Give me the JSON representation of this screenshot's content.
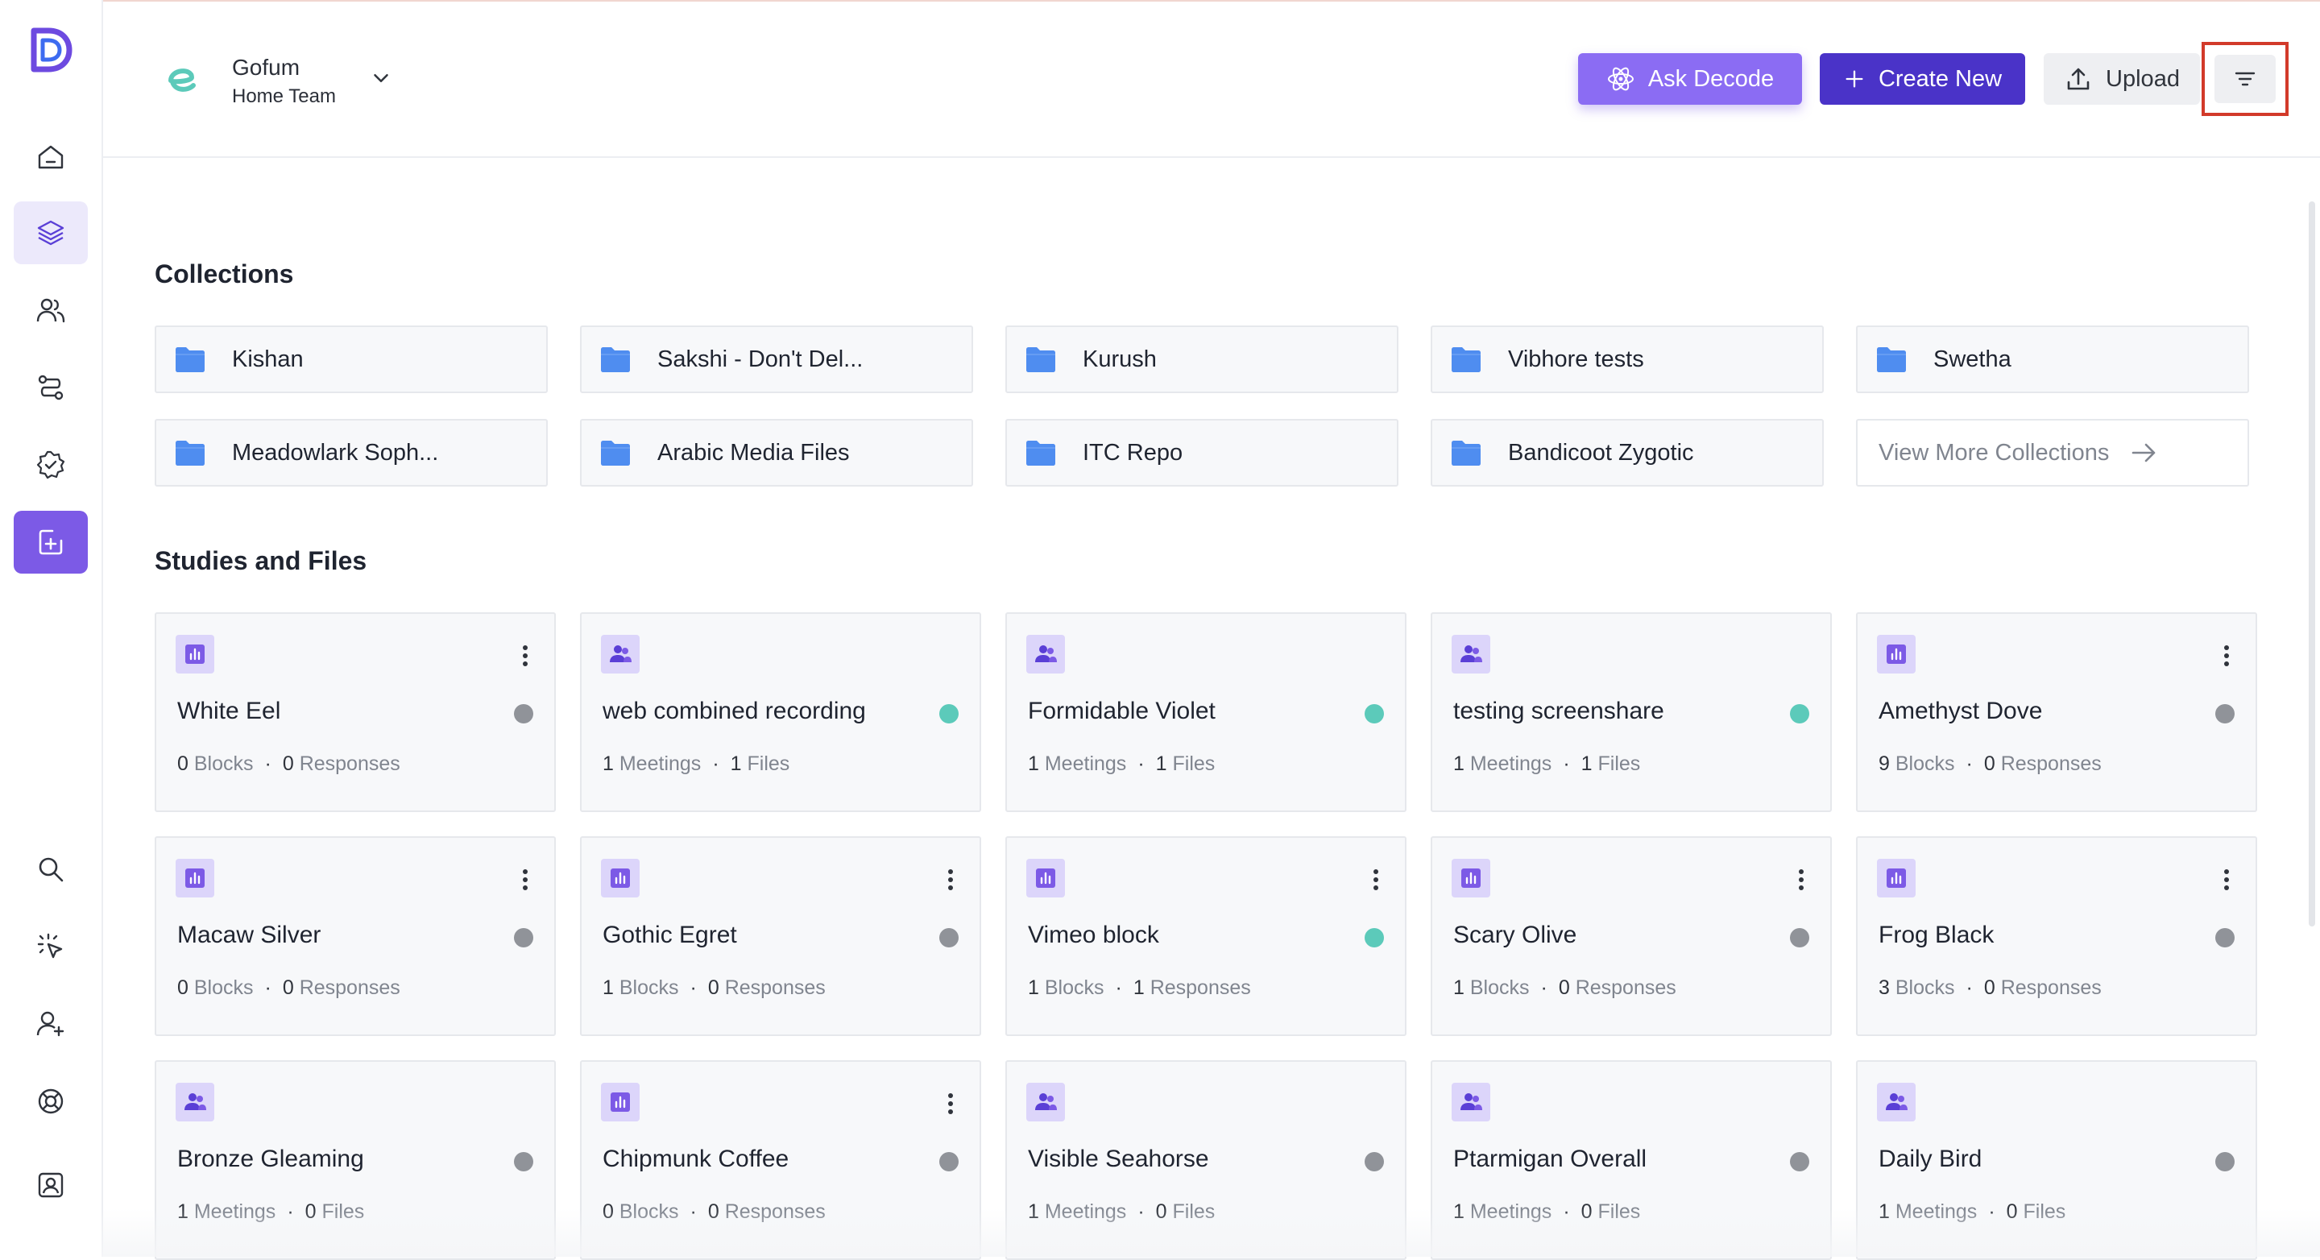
{
  "colors": {
    "accent": "#7c5ae6",
    "ask_button": "#8b6cf3",
    "create_button": "#4a33c8",
    "highlight": "#d23a2a",
    "status_active": "#5ccaba",
    "status_inactive": "#909399"
  },
  "sidebar": {
    "items": [
      {
        "name": "home",
        "icon": "home-icon"
      },
      {
        "name": "library",
        "icon": "layers-icon",
        "selected": true
      },
      {
        "name": "participants",
        "icon": "users-icon"
      },
      {
        "name": "flows",
        "icon": "route-icon"
      },
      {
        "name": "tasks",
        "icon": "check-circle-icon"
      },
      {
        "name": "new",
        "icon": "add-file-icon",
        "primary": true
      }
    ],
    "bottom_items": [
      {
        "name": "search",
        "icon": "search-icon"
      },
      {
        "name": "click-test",
        "icon": "cursor-click-icon"
      },
      {
        "name": "invite",
        "icon": "user-plus-icon"
      },
      {
        "name": "help",
        "icon": "lifebuoy-icon"
      },
      {
        "name": "profile",
        "icon": "user-card-icon"
      }
    ]
  },
  "header": {
    "workspace_name": "Gofum",
    "workspace_team": "Home Team",
    "ask_label": "Ask Decode",
    "create_label": "Create New",
    "upload_label": "Upload"
  },
  "collections": {
    "title": "Collections",
    "items": [
      "Kishan",
      "Sakshi - Don't Del...",
      "Kurush",
      "Vibhore tests",
      "Swetha",
      "Meadowlark Soph...",
      "Arabic Media Files",
      "ITC Repo",
      "Bandicoot Zygotic"
    ],
    "view_more_label": "View More Collections"
  },
  "studies": {
    "title": "Studies and Files",
    "items": [
      {
        "title": "White Eel",
        "kind": "block",
        "status": "inactive",
        "menu": true,
        "count1": "0",
        "label1": "Blocks",
        "count2": "0",
        "label2": "Responses"
      },
      {
        "title": "web combined recording",
        "kind": "meeting",
        "status": "active",
        "menu": false,
        "count1": "1",
        "label1": "Meetings",
        "count2": "1",
        "label2": "Files"
      },
      {
        "title": "Formidable Violet",
        "kind": "meeting",
        "status": "active",
        "menu": false,
        "count1": "1",
        "label1": "Meetings",
        "count2": "1",
        "label2": "Files"
      },
      {
        "title": "testing screenshare",
        "kind": "meeting",
        "status": "active",
        "menu": false,
        "count1": "1",
        "label1": "Meetings",
        "count2": "1",
        "label2": "Files"
      },
      {
        "title": "Amethyst Dove",
        "kind": "block",
        "status": "inactive",
        "menu": true,
        "count1": "9",
        "label1": "Blocks",
        "count2": "0",
        "label2": "Responses"
      },
      {
        "title": "Macaw Silver",
        "kind": "block",
        "status": "inactive",
        "menu": true,
        "count1": "0",
        "label1": "Blocks",
        "count2": "0",
        "label2": "Responses"
      },
      {
        "title": "Gothic Egret",
        "kind": "block",
        "status": "inactive",
        "menu": true,
        "count1": "1",
        "label1": "Blocks",
        "count2": "0",
        "label2": "Responses"
      },
      {
        "title": "Vimeo block",
        "kind": "block",
        "status": "active",
        "menu": true,
        "count1": "1",
        "label1": "Blocks",
        "count2": "1",
        "label2": "Responses"
      },
      {
        "title": "Scary Olive",
        "kind": "block",
        "status": "inactive",
        "menu": true,
        "count1": "1",
        "label1": "Blocks",
        "count2": "0",
        "label2": "Responses"
      },
      {
        "title": "Frog Black",
        "kind": "block",
        "status": "inactive",
        "menu": true,
        "count1": "3",
        "label1": "Blocks",
        "count2": "0",
        "label2": "Responses"
      },
      {
        "title": "Bronze Gleaming",
        "kind": "meeting",
        "status": "inactive",
        "menu": false,
        "count1": "1",
        "label1": "Meetings",
        "count2": "0",
        "label2": "Files"
      },
      {
        "title": "Chipmunk Coffee",
        "kind": "block",
        "status": "inactive",
        "menu": true,
        "count1": "0",
        "label1": "Blocks",
        "count2": "0",
        "label2": "Responses"
      },
      {
        "title": "Visible Seahorse",
        "kind": "meeting",
        "status": "inactive",
        "menu": false,
        "count1": "1",
        "label1": "Meetings",
        "count2": "0",
        "label2": "Files"
      },
      {
        "title": "Ptarmigan Overall",
        "kind": "meeting",
        "status": "inactive",
        "menu": false,
        "count1": "1",
        "label1": "Meetings",
        "count2": "0",
        "label2": "Files"
      },
      {
        "title": "Daily Bird",
        "kind": "meeting",
        "status": "inactive",
        "menu": false,
        "count1": "1",
        "label1": "Meetings",
        "count2": "0",
        "label2": "Files"
      }
    ]
  }
}
